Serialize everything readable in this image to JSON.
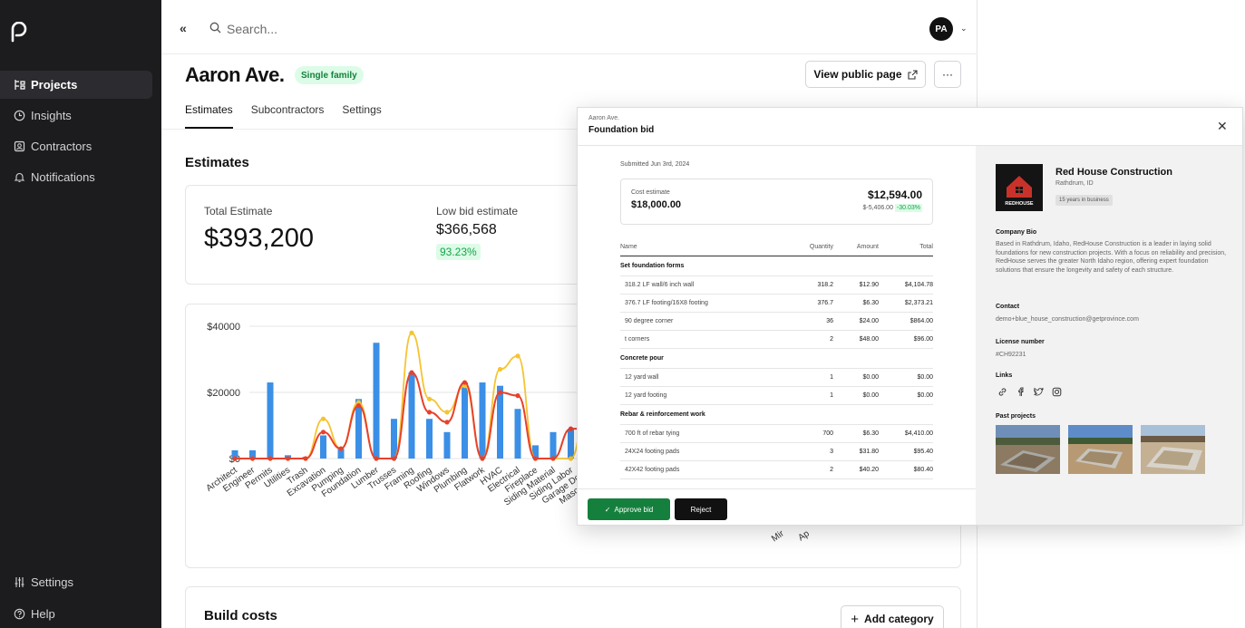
{
  "sidebar": {
    "items": [
      {
        "label": "Projects",
        "icon": "projects-icon",
        "active": true
      },
      {
        "label": "Insights",
        "icon": "insights-icon"
      },
      {
        "label": "Contractors",
        "icon": "contractors-icon"
      },
      {
        "label": "Notifications",
        "icon": "bell-icon"
      }
    ],
    "bottom": [
      {
        "label": "Settings",
        "icon": "sliders-icon"
      },
      {
        "label": "Help",
        "icon": "help-icon"
      }
    ]
  },
  "topbar": {
    "collapse": "«",
    "search_placeholder": "Search...",
    "avatar_initials": "PA"
  },
  "project": {
    "title": "Aaron Ave.",
    "badge": "Single family",
    "view_public": "View public page",
    "more": "···"
  },
  "tabs": [
    "Estimates",
    "Subcontractors",
    "Settings"
  ],
  "estimates": {
    "section_title": "Estimates",
    "total_label": "Total Estimate",
    "total_value": "$393,200",
    "low_label": "Low bid estimate",
    "low_value": "$366,568",
    "low_pct": "93.23%"
  },
  "chart_data": {
    "type": "bar",
    "title": "",
    "xlabel": "",
    "ylabel": "",
    "ylim": [
      0,
      40000
    ],
    "yticks": [
      "$0",
      "$20000",
      "$40000"
    ],
    "categories": [
      "Architect",
      "Engineer",
      "Permits",
      "Utilities",
      "Trash",
      "Excavation",
      "Pumping",
      "Foundation",
      "Lumber",
      "Trusses",
      "Framing",
      "Roofing",
      "Windows",
      "Plumbing",
      "Flatwork",
      "HVAC",
      "Electrical",
      "Fireplace",
      "Siding Material",
      "Siding Labor",
      "Garage Doors",
      "Masonry Mate",
      "Mason"
    ],
    "extra_tick_labels": [
      "Mir",
      "Ap"
    ],
    "series": [
      {
        "values": [
          2500,
          2500,
          23000,
          1000,
          500,
          7000,
          3000,
          18000,
          35000,
          12000,
          26000,
          12000,
          8000,
          23000,
          23000,
          22000,
          15000,
          4000,
          8000,
          9000,
          6000
        ]
      },
      {
        "values": [
          0,
          0,
          0,
          0,
          0,
          12000,
          3000,
          17000,
          0,
          0,
          38000,
          18000,
          14000,
          22000,
          0,
          27000,
          31000,
          0,
          0,
          0,
          19000
        ]
      },
      {
        "values": [
          0,
          0,
          0,
          0,
          0,
          8000,
          3000,
          16000,
          0,
          0,
          26000,
          14000,
          11000,
          23000,
          0,
          20000,
          19000,
          0,
          0,
          9000,
          9000
        ]
      }
    ],
    "colors": [
      "#3b8fe6",
      "#f5c431",
      "#e8412b"
    ],
    "grid": true
  },
  "build": {
    "title": "Build costs",
    "add_category": "Add category"
  },
  "modal": {
    "crumb": "Aaron Ave.",
    "title": "Foundation bid",
    "submitted": "Submitted Jun 3rd, 2024",
    "cost_label": "Cost estimate",
    "cost_estimate": "$18,000.00",
    "bid_total": "$12,594.00",
    "diff": "$-5,406.00",
    "diff_pct": "-30.03%",
    "columns": [
      "Name",
      "Quantity",
      "Amount",
      "Total"
    ],
    "groups": [
      {
        "name": "Set foundation forms",
        "rows": [
          [
            "318.2 LF wall/6 inch wall",
            "318.2",
            "$12.90",
            "$4,104.78"
          ],
          [
            "376.7 LF footing/16X8 footing",
            "376.7",
            "$6.30",
            "$2,373.21"
          ],
          [
            "90 degree corner",
            "36",
            "$24.00",
            "$864.00"
          ],
          [
            "t corners",
            "2",
            "$48.00",
            "$96.00"
          ]
        ]
      },
      {
        "name": "Concrete pour",
        "rows": [
          [
            "12 yard wall",
            "1",
            "$0.00",
            "$0.00"
          ],
          [
            "12 yard footing",
            "1",
            "$0.00",
            "$0.00"
          ]
        ]
      },
      {
        "name": "Rebar & reinforcement work",
        "rows": [
          [
            "700 ft of rebar tying",
            "700",
            "$6.30",
            "$4,410.00"
          ],
          [
            "24X24 footing pads",
            "3",
            "$31.80",
            "$95.40"
          ],
          [
            "42X42 footing pads",
            "2",
            "$40.20",
            "$80.40"
          ]
        ]
      }
    ],
    "approve": "Approve bid",
    "reject": "Reject",
    "company": {
      "name": "Red House Construction",
      "location": "Rathdrum, ID",
      "years": "15 years in business",
      "logo_text": "REDHOUSE",
      "bio_label": "Company Bio",
      "bio": "Based in Rathdrum, Idaho, RedHouse Construction is a leader in laying solid foundations for new construction projects. With a focus on reliability and precision, RedHouse serves the greater North Idaho region, offering expert foundation solutions that ensure the longevity and safety of each structure.",
      "contact_label": "Contact",
      "contact": "demo+blue_house_construction@getprovince.com",
      "license_label": "License number",
      "license": "#CH92231",
      "links_label": "Links",
      "past_label": "Past projects"
    }
  }
}
